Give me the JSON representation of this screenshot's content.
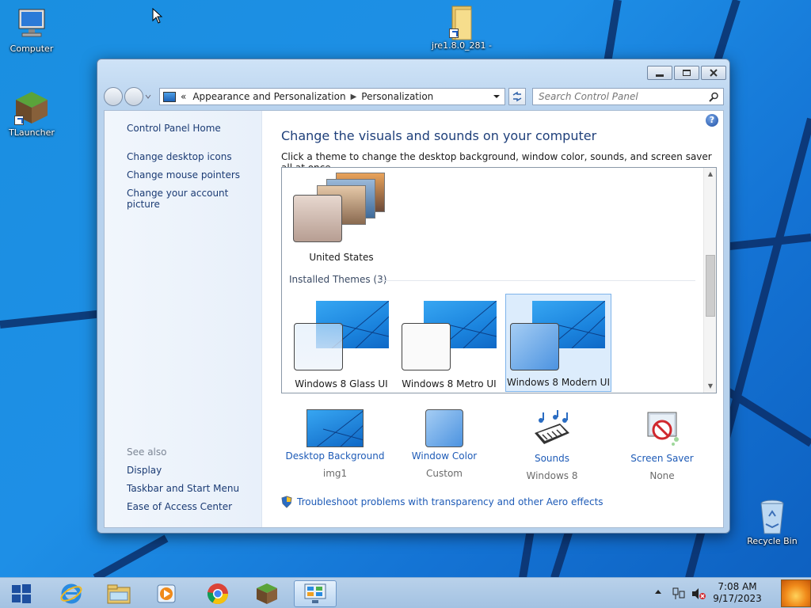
{
  "desktop": {
    "icons": [
      {
        "label": "Computer"
      },
      {
        "label": "TLauncher"
      },
      {
        "label": "jre1.8.0_281 -"
      },
      {
        "label": "Recycle Bin"
      }
    ]
  },
  "window": {
    "breadcrumb": {
      "overflow": "«",
      "items": [
        "Appearance and Personalization",
        "Personalization"
      ]
    },
    "search": {
      "placeholder": "Search Control Panel"
    },
    "help_label": "?",
    "sidebar": {
      "home": "Control Panel Home",
      "links": [
        "Change desktop icons",
        "Change mouse pointers",
        "Change your account picture"
      ],
      "see_also_label": "See also",
      "see_also": [
        "Display",
        "Taskbar and Start Menu",
        "Ease of Access Center"
      ]
    },
    "main": {
      "heading": "Change the visuals and sounds on your computer",
      "subtext": "Click a theme to change the desktop background, window color, sounds, and screen saver all at once.",
      "top_theme": "United States",
      "installed_label": "Installed Themes (3)",
      "themes": [
        {
          "name": "Windows 8 Glass UI",
          "selected": false
        },
        {
          "name": "Windows 8 Metro UI",
          "selected": false
        },
        {
          "name": "Windows 8 Modern UI",
          "selected": true
        }
      ],
      "settings": [
        {
          "label": "Desktop Background",
          "value": "img1"
        },
        {
          "label": "Window Color",
          "value": "Custom"
        },
        {
          "label": "Sounds",
          "value": "Windows 8"
        },
        {
          "label": "Screen Saver",
          "value": "None"
        }
      ],
      "troubleshoot": "Troubleshoot problems with transparency and other Aero effects"
    }
  },
  "taskbar": {
    "apps": [
      "start",
      "internet-explorer",
      "file-explorer",
      "media-player",
      "chrome",
      "minecraft",
      "control-panel"
    ],
    "time": "7:08 AM",
    "date": "9/17/2023"
  },
  "colors": {
    "accent": "#1e8fe6",
    "link": "#1e5bb7",
    "heading": "#1e3f7a"
  }
}
